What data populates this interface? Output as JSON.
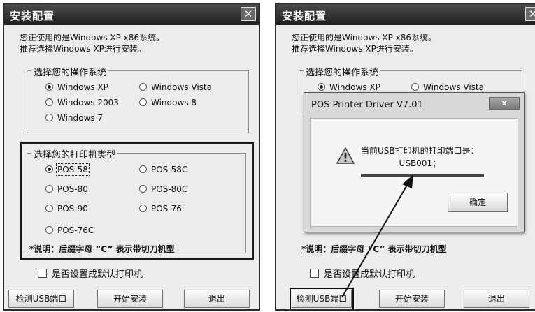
{
  "left_window": {
    "title": "安装配置",
    "close_glyph": "✕",
    "intro_line1": "您正使用的是Windows XP x86系统。",
    "intro_line2": "推荐选择Windows XP进行安装。",
    "os_group": {
      "legend": "选择您的操作系统",
      "options": [
        "Windows XP",
        "Windows Vista",
        "Windows 2003",
        "Windows 8",
        "Windows 7"
      ],
      "selected": "Windows XP"
    },
    "printer_group": {
      "legend": "选择您的打印机类型",
      "options": [
        "POS-58",
        "POS-58C",
        "POS-80",
        "POS-80C",
        "POS-90",
        "POS-76",
        "POS-76C"
      ],
      "selected": "POS-58"
    },
    "note": "*说明：后缀字母 “C” 表示带切刀机型",
    "default_printer_label": "是否设置成默认打印机",
    "buttons": {
      "detect": "检测USB端口",
      "install": "开始安装",
      "exit": "退出"
    }
  },
  "right_window": {
    "title": "安装配置",
    "close_glyph": "✕",
    "intro_line1": "您正使用的是Windows XP x86系统。",
    "intro_line2": "推荐选择Windows XP进行安装。",
    "os_group": {
      "legend": "选择您的操作系统",
      "options": [
        "Windows XP",
        "Windows Vista"
      ],
      "selected": "Windows XP"
    },
    "note": "*说明：后缀字母 “C” 表示带切刀机型",
    "default_printer_label": "是否设置成默认打印机",
    "buttons": {
      "detect": "检测USB端口",
      "install": "开始安装",
      "exit": "退出"
    },
    "dialog": {
      "title": "POS Printer Driver V7.01",
      "close_glyph": "x",
      "message_line1": "当前USB打印机的打印端口是：",
      "message_line2": "USB001；",
      "ok_label": "确定"
    }
  },
  "icons": {
    "warning": "warning-icon",
    "close": "close-icon",
    "arrow": "annotation-arrow-icon"
  }
}
